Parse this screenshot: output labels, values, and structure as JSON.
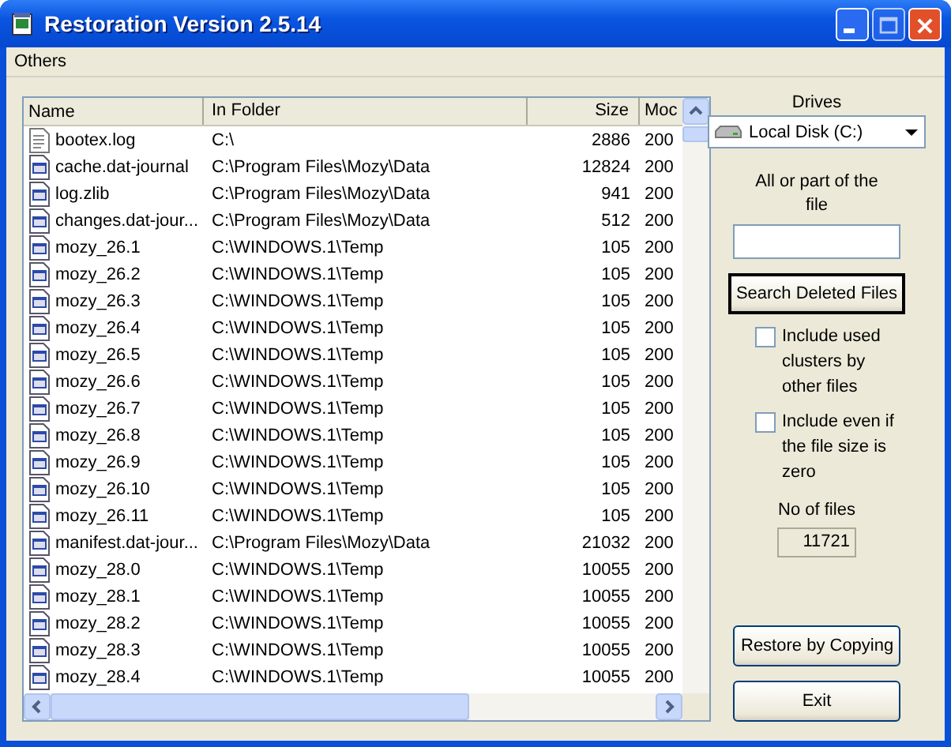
{
  "window": {
    "title": "Restoration Version 2.5.14"
  },
  "menu": [
    "Others"
  ],
  "table": {
    "columns": [
      "Name",
      "In Folder",
      "Size",
      "Moc"
    ],
    "rows": [
      {
        "kind": "text",
        "name": "bootex.log",
        "folder": "C:\\",
        "size": "2886",
        "modified": "200"
      },
      {
        "kind": "app",
        "name": "cache.dat-journal",
        "folder": "C:\\Program Files\\Mozy\\Data",
        "size": "12824",
        "modified": "200"
      },
      {
        "kind": "app",
        "name": "log.zlib",
        "folder": "C:\\Program Files\\Mozy\\Data",
        "size": "941",
        "modified": "200"
      },
      {
        "kind": "app",
        "name": "changes.dat-jour...",
        "folder": "C:\\Program Files\\Mozy\\Data",
        "size": "512",
        "modified": "200"
      },
      {
        "kind": "app",
        "name": "mozy_26.1",
        "folder": "C:\\WINDOWS.1\\Temp",
        "size": "105",
        "modified": "200"
      },
      {
        "kind": "app",
        "name": "mozy_26.2",
        "folder": "C:\\WINDOWS.1\\Temp",
        "size": "105",
        "modified": "200"
      },
      {
        "kind": "app",
        "name": "mozy_26.3",
        "folder": "C:\\WINDOWS.1\\Temp",
        "size": "105",
        "modified": "200"
      },
      {
        "kind": "app",
        "name": "mozy_26.4",
        "folder": "C:\\WINDOWS.1\\Temp",
        "size": "105",
        "modified": "200"
      },
      {
        "kind": "app",
        "name": "mozy_26.5",
        "folder": "C:\\WINDOWS.1\\Temp",
        "size": "105",
        "modified": "200"
      },
      {
        "kind": "app",
        "name": "mozy_26.6",
        "folder": "C:\\WINDOWS.1\\Temp",
        "size": "105",
        "modified": "200"
      },
      {
        "kind": "app",
        "name": "mozy_26.7",
        "folder": "C:\\WINDOWS.1\\Temp",
        "size": "105",
        "modified": "200"
      },
      {
        "kind": "app",
        "name": "mozy_26.8",
        "folder": "C:\\WINDOWS.1\\Temp",
        "size": "105",
        "modified": "200"
      },
      {
        "kind": "app",
        "name": "mozy_26.9",
        "folder": "C:\\WINDOWS.1\\Temp",
        "size": "105",
        "modified": "200"
      },
      {
        "kind": "app",
        "name": "mozy_26.10",
        "folder": "C:\\WINDOWS.1\\Temp",
        "size": "105",
        "modified": "200"
      },
      {
        "kind": "app",
        "name": "mozy_26.11",
        "folder": "C:\\WINDOWS.1\\Temp",
        "size": "105",
        "modified": "200"
      },
      {
        "kind": "app",
        "name": "manifest.dat-jour...",
        "folder": "C:\\Program Files\\Mozy\\Data",
        "size": "21032",
        "modified": "200"
      },
      {
        "kind": "app",
        "name": "mozy_28.0",
        "folder": "C:\\WINDOWS.1\\Temp",
        "size": "10055",
        "modified": "200"
      },
      {
        "kind": "app",
        "name": "mozy_28.1",
        "folder": "C:\\WINDOWS.1\\Temp",
        "size": "10055",
        "modified": "200"
      },
      {
        "kind": "app",
        "name": "mozy_28.2",
        "folder": "C:\\WINDOWS.1\\Temp",
        "size": "10055",
        "modified": "200"
      },
      {
        "kind": "app",
        "name": "mozy_28.3",
        "folder": "C:\\WINDOWS.1\\Temp",
        "size": "10055",
        "modified": "200"
      },
      {
        "kind": "app",
        "name": "mozy_28.4",
        "folder": "C:\\WINDOWS.1\\Temp",
        "size": "10055",
        "modified": "200"
      }
    ]
  },
  "side": {
    "drives_label": "Drives",
    "drive": "Local Disk (C:)",
    "file_label": "All or part of the file",
    "search_button": "Search Deleted Files",
    "options": [
      {
        "label": "Include used clusters by other files",
        "checked": false
      },
      {
        "label": "Include even if the file size is zero",
        "checked": false
      }
    ],
    "count_label": "No of files",
    "count": "11721",
    "restore_button": "Restore by Copying",
    "exit_button": "Exit"
  }
}
